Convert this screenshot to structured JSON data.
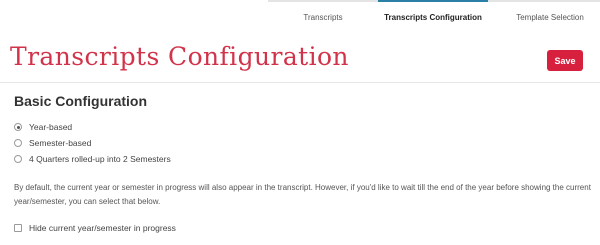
{
  "tabs": [
    {
      "label": "Transcripts",
      "active": false
    },
    {
      "label": "Transcripts Configuration",
      "active": true
    },
    {
      "label": "Template Selection",
      "active": false
    }
  ],
  "page": {
    "title": "Transcripts Configuration",
    "save_label": "Save"
  },
  "basic": {
    "heading": "Basic Configuration",
    "options": [
      {
        "label": "Year-based",
        "checked": true
      },
      {
        "label": "Semester-based",
        "checked": false
      },
      {
        "label": "4 Quarters rolled-up into 2 Semesters",
        "checked": false
      }
    ],
    "description": "By default, the current year or semester in progress will also appear in the transcript. However, if you'd like to wait till the end of the year before showing the current year/semester, you can select that below.",
    "hide_checkbox": {
      "label": "Hide current year/semester in progress",
      "checked": false
    }
  },
  "colors": {
    "accent": "#d1344a",
    "button": "#d6203d",
    "active_tab": "#2a7fa6"
  }
}
